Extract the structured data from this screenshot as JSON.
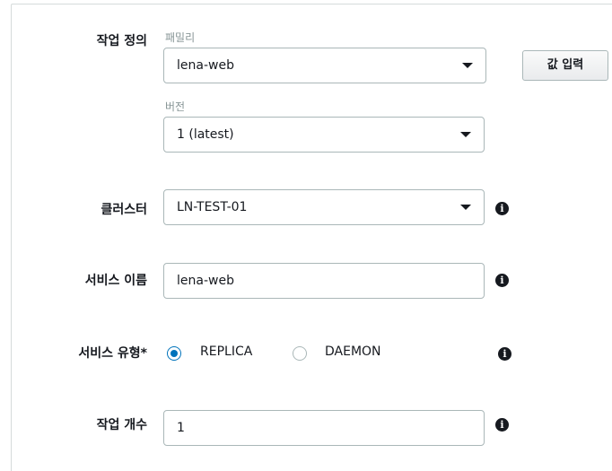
{
  "task_definition": {
    "label": "작업 정의",
    "family": {
      "sublabel": "패밀리",
      "value": "lena-web"
    },
    "revision": {
      "sublabel": "버전",
      "value": "1 (latest)"
    },
    "enter_value_button": "값 입력"
  },
  "cluster": {
    "label": "클러스터",
    "value": "LN-TEST-01"
  },
  "service_name": {
    "label": "서비스 이름",
    "value": "lena-web"
  },
  "service_type": {
    "label": "서비스 유형*",
    "options": [
      {
        "label": "REPLICA",
        "selected": true
      },
      {
        "label": "DAEMON",
        "selected": false
      }
    ]
  },
  "task_count": {
    "label": "작업 개수",
    "value": "1"
  },
  "icons": {
    "info": "info-icon",
    "dropdown": "caret-down-icon"
  },
  "colors": {
    "accent": "#0073bb",
    "border": "#aab7b8",
    "text": "#16191f"
  }
}
